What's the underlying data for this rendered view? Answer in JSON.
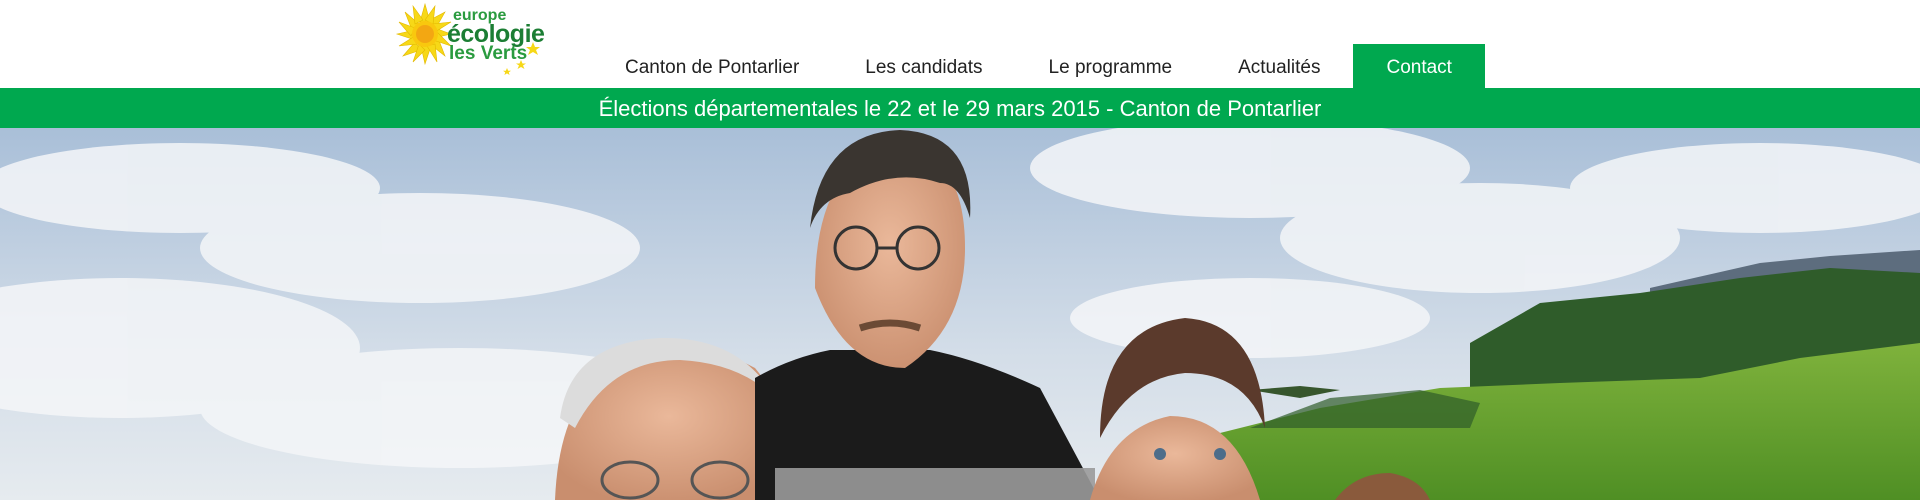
{
  "logo": {
    "line1": "europe",
    "line2": "écologie",
    "line3": "les Verts"
  },
  "nav": {
    "items": [
      {
        "label": "Canton de Pontarlier"
      },
      {
        "label": "Les candidats"
      },
      {
        "label": "Le programme"
      },
      {
        "label": "Actualités"
      },
      {
        "label": "Contact",
        "active": true
      }
    ]
  },
  "banner": {
    "text": "Élections départementales le 22 et le 29 mars 2015 - Canton de Pontarlier"
  },
  "colors": {
    "brand_green": "#00a84f",
    "logo_yellow": "#f7d817"
  }
}
